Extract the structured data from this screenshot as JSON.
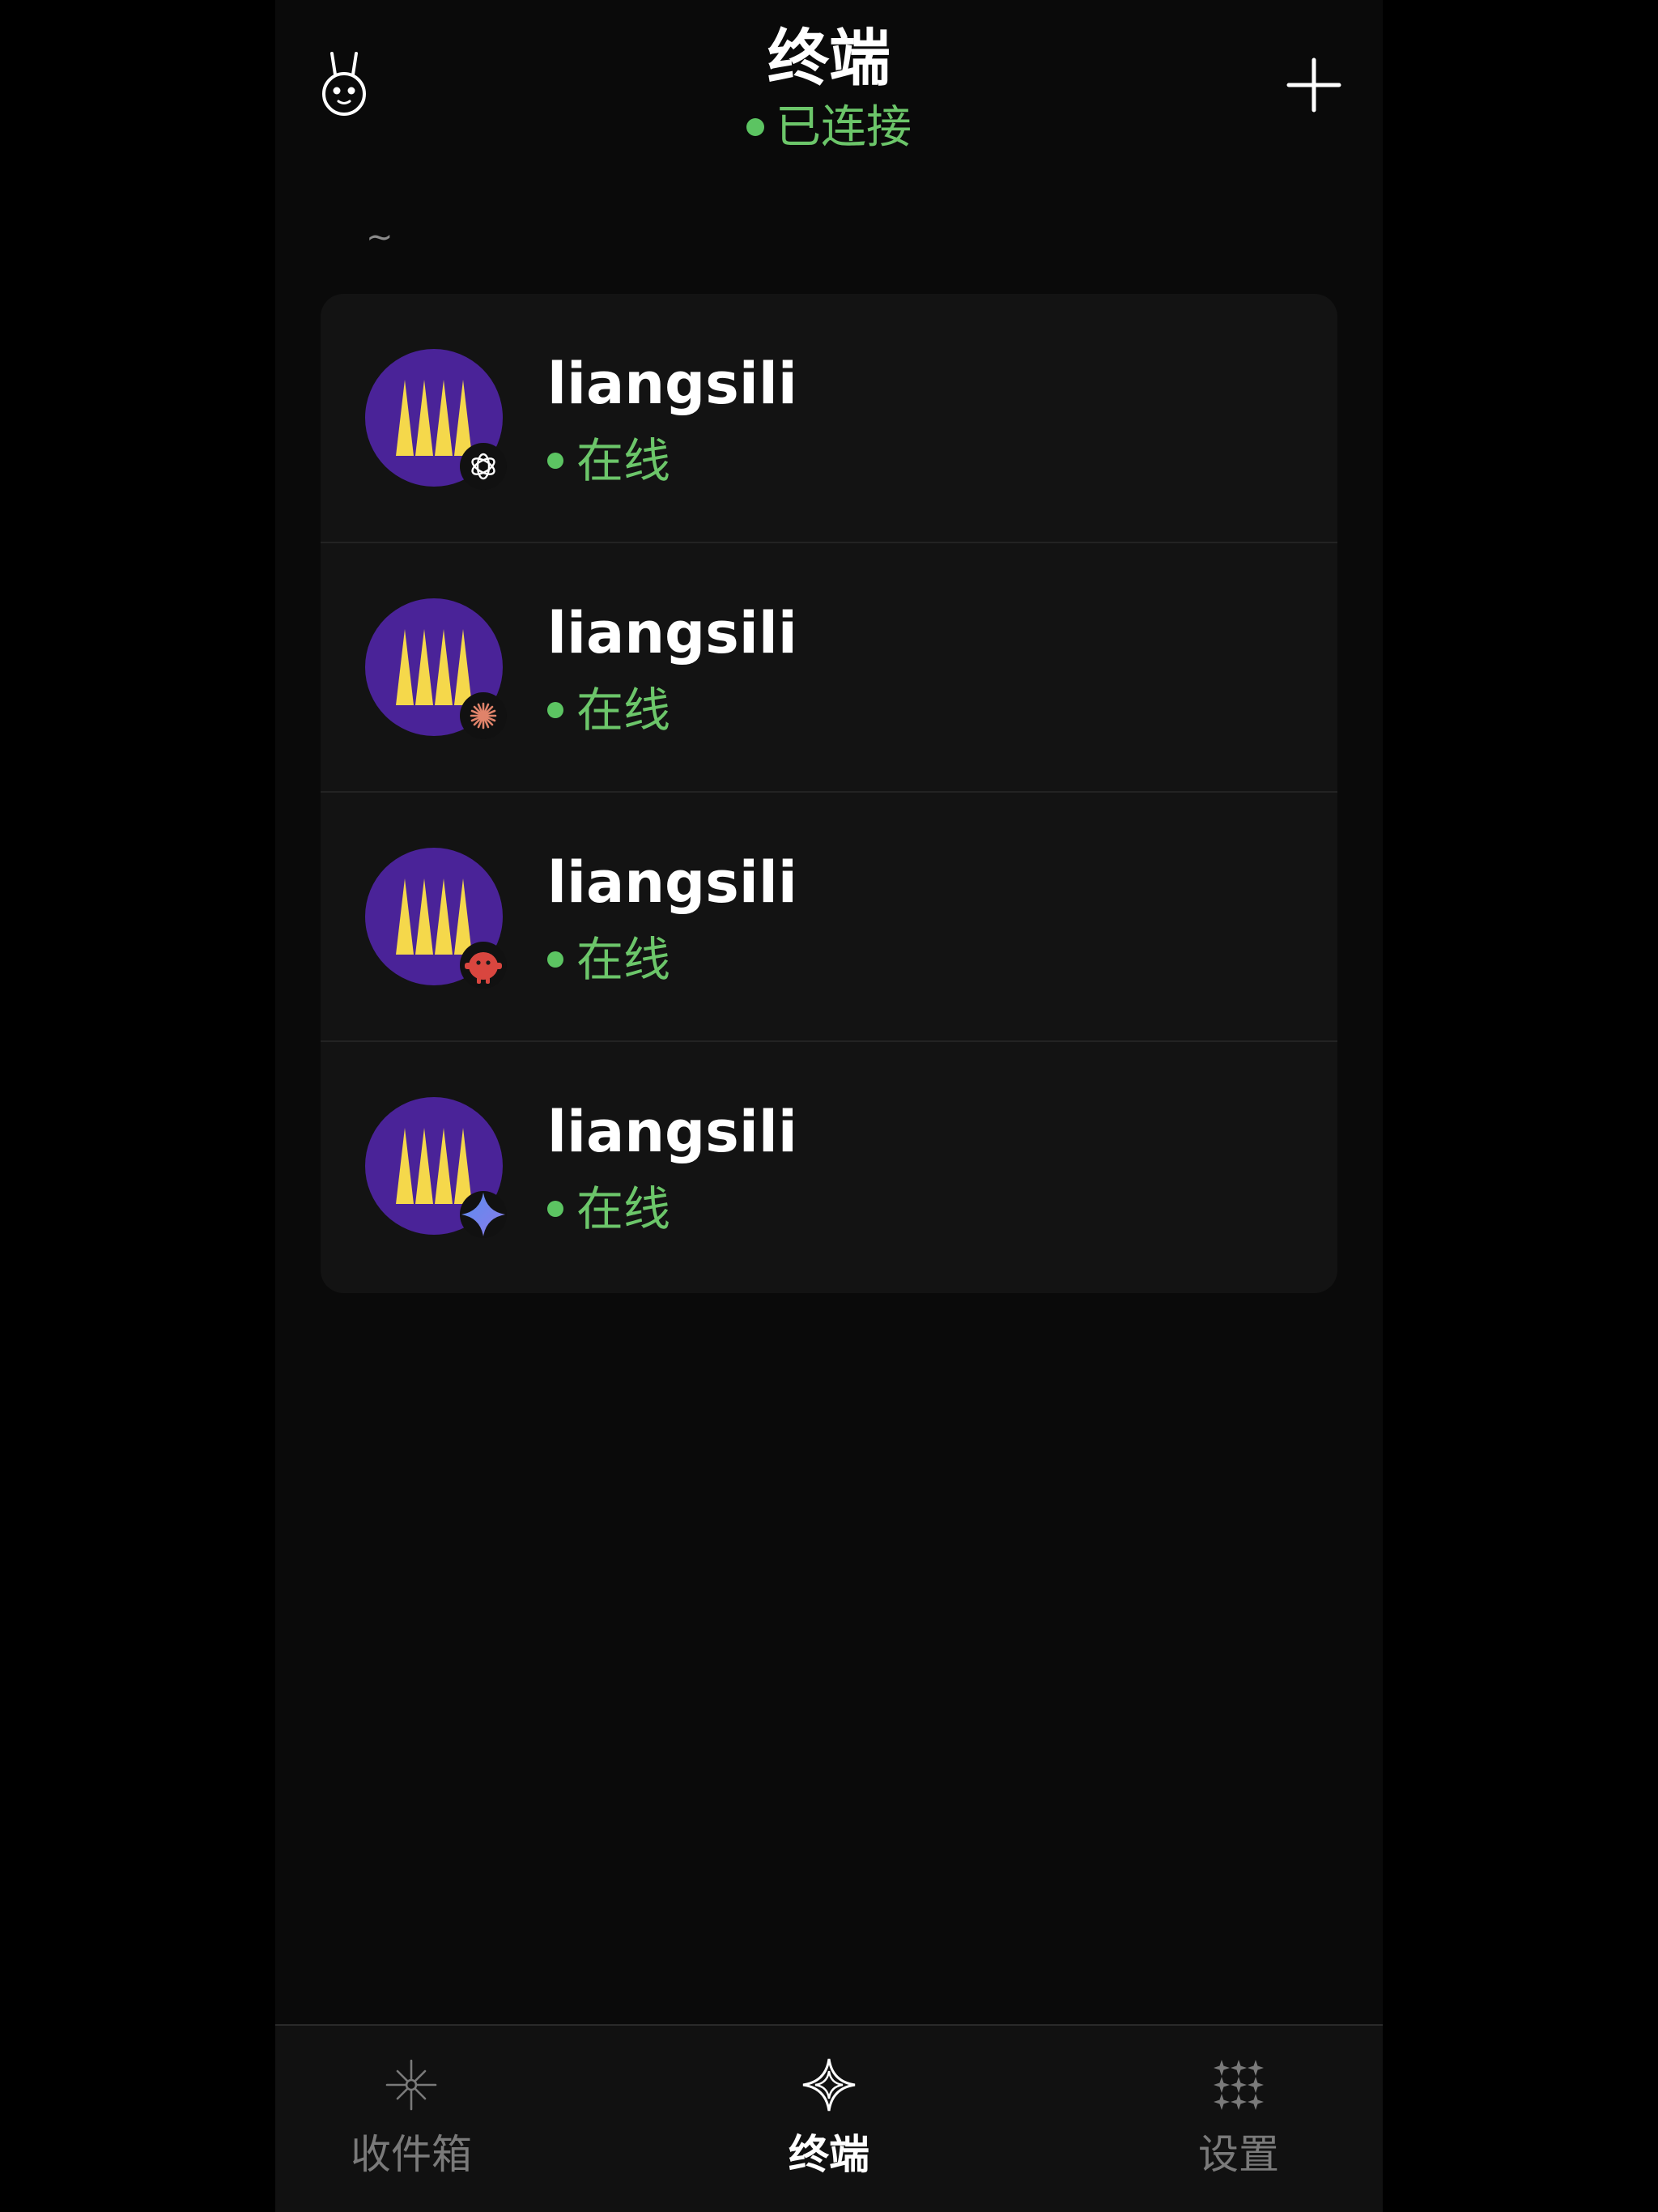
{
  "header": {
    "title": "终端",
    "connection_status": "已连接",
    "left_icon": "bunny-icon",
    "right_icon": "plus-icon"
  },
  "path_label": "~",
  "sessions": [
    {
      "name": "liangsili",
      "status": "在线",
      "agent_icon": "openai-icon"
    },
    {
      "name": "liangsili",
      "status": "在线",
      "agent_icon": "claude-icon"
    },
    {
      "name": "liangsili",
      "status": "在线",
      "agent_icon": "red-bot-icon"
    },
    {
      "name": "liangsili",
      "status": "在线",
      "agent_icon": "gemini-icon"
    }
  ],
  "tabs": [
    {
      "label": "收件箱",
      "icon": "inbox-sparkle-icon",
      "active": false
    },
    {
      "label": "终端",
      "icon": "terminal-star-icon",
      "active": true
    },
    {
      "label": "设置",
      "icon": "settings-grid-icon",
      "active": false
    }
  ],
  "colors": {
    "background": "#0a0a0a",
    "card": "#131313",
    "online_green": "#6cc66a",
    "avatar_purple": "#4a2398",
    "avatar_yellow": "#f5d84b"
  }
}
